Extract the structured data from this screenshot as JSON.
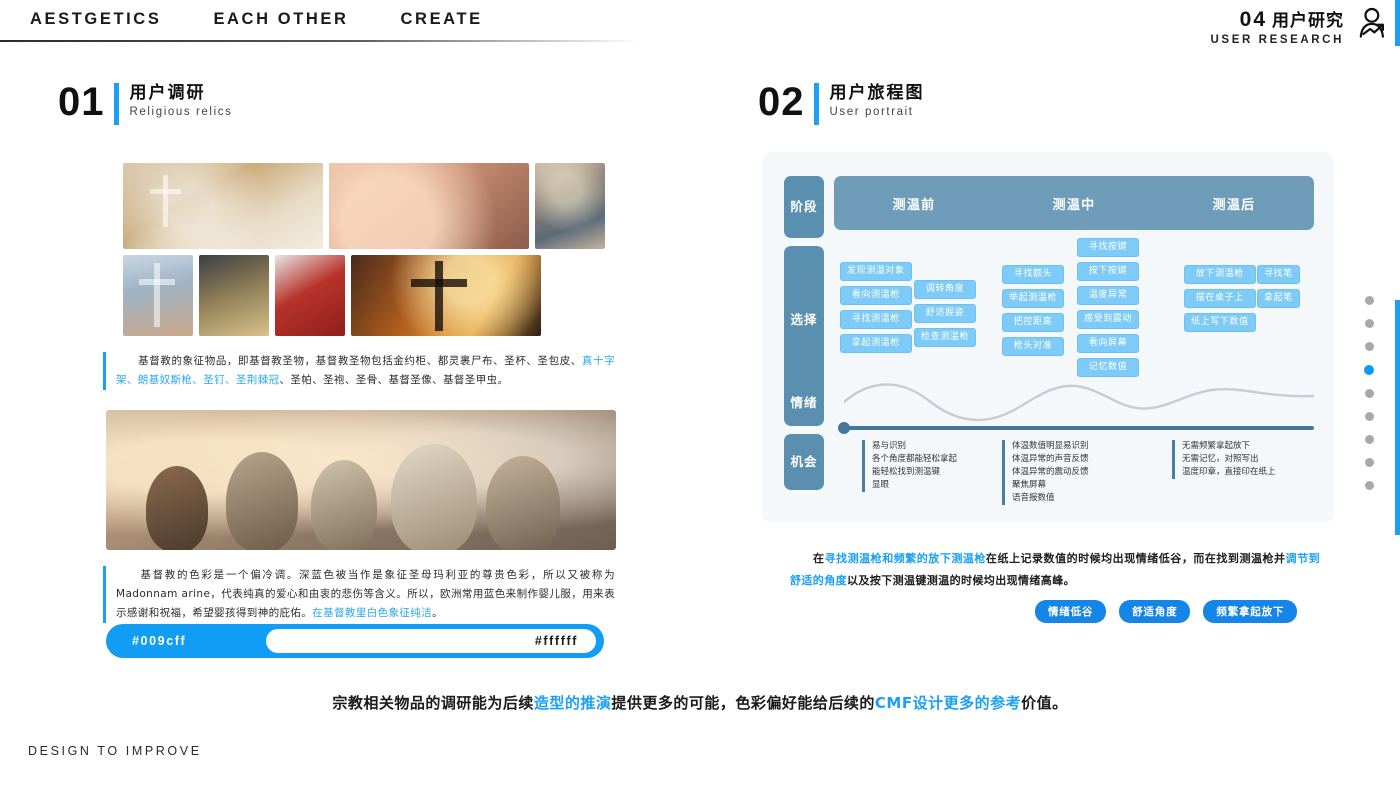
{
  "topbar": {
    "nav": [
      "AESTGETICS",
      "EACH OTHER",
      "CREATE"
    ],
    "chapter_num": "04",
    "chapter_cn": "用户研究",
    "chapter_en": "USER RESEARCH",
    "person_icon": "person-research-icon"
  },
  "section01": {
    "num": "01",
    "title_cn": "用户调研",
    "title_en": "Religious relics",
    "paragraph1": {
      "part1": "　　基督教的象征物品，即基督教圣物，基督教圣物包括金约柜、都灵裹尸布、圣杯、圣包皮、",
      "highlight1": "真十字架、朗基奴斯枪、圣钉、圣荆棘冠",
      "part2": "、圣帕、圣袍、圣骨、基督圣像、基督圣甲虫。"
    },
    "paragraph2": {
      "part1": "　　基督教的色彩是一个偏冷调。深蓝色被当作是象征圣母玛利亚的尊贵色彩，所以又被称为Madonnam arine，代表纯真的爱心和由衷的悲伤等含义。所以，欧洲常用蓝色来制作婴儿服，用来表示感谢和祝福，希望婴孩得到神的庇佑。",
      "highlight1": "在基督教里白色象征纯洁",
      "part2": "。"
    },
    "swatch": {
      "color_primary": "#009cff",
      "label_primary": "#009cff",
      "color_secondary": "#ffffff",
      "label_secondary": "#ffffff"
    }
  },
  "section02": {
    "num": "02",
    "title_cn": "用户旅程图",
    "title_en": "User portrait",
    "rows": {
      "phase": "阶段",
      "select": "选择",
      "emotion": "情绪",
      "chance": "机会"
    },
    "phases": [
      "测温前",
      "测温中",
      "测温后"
    ],
    "tag_groups": [
      {
        "tags": [
          "发现测温对象",
          "看向测温枪",
          "寻找测温枪",
          "拿起测温枪"
        ]
      },
      {
        "tags": [
          "调转角度",
          "舒适握姿",
          "检查测温枪"
        ]
      },
      {
        "tags": [
          "寻找额头",
          "举起测温枪",
          "把控距离",
          "枪头对准"
        ]
      },
      {
        "tags": [
          "寻找按键",
          "按下按键",
          "温度异常",
          "感受到震动",
          "看向屏幕",
          "记忆数值"
        ]
      },
      {
        "tags": [
          "放下测温枪",
          "摆在桌子上",
          "纸上写下数值"
        ]
      },
      {
        "tags": [
          "寻找笔",
          "拿起笔"
        ]
      }
    ],
    "opportunities": [
      {
        "lines": [
          "易与识别",
          "各个角度都能轻松拿起",
          "能轻松找到测温键",
          "显眼"
        ]
      },
      {
        "lines": [
          "体温数值明显易识别",
          "体温异常的声音反馈",
          "体温异常的震动反馈",
          "聚焦屏幕",
          "语音报数值"
        ]
      },
      {
        "lines": [
          "无需频繁拿起放下",
          "无需记忆，对照写出",
          "温度印章，直接印在纸上"
        ]
      }
    ],
    "conclusion": {
      "part1": "　　在",
      "highlight1": "寻找测温枪和频繁的放下测温枪",
      "part2": "在纸上记录数值的时候均出现情绪低谷，而在找到测温枪并",
      "highlight2": "调节到舒适的角度",
      "part3": "以及按下测温键测温的时候均出现情绪高峰。"
    },
    "pills": [
      "情绪低谷",
      "舒适角度",
      "频繁拿起放下"
    ]
  },
  "summary": {
    "part1": "宗教相关物品的调研能为后续",
    "highlight1": "造型的推演",
    "part2": "提供更多的可能，色彩偏好能给后续的",
    "highlight2": "CMF设计更多的参考",
    "part3": "价值。"
  },
  "footer": {
    "text": "DESIGN TO IMPROVE"
  },
  "pager": {
    "total": 9,
    "active_index": 3
  },
  "colors": {
    "accent": "#1ca0f7",
    "journey_blue": "#6f9db9",
    "tag_blue": "#7ecbf7",
    "pill_blue": "#1585e8"
  }
}
